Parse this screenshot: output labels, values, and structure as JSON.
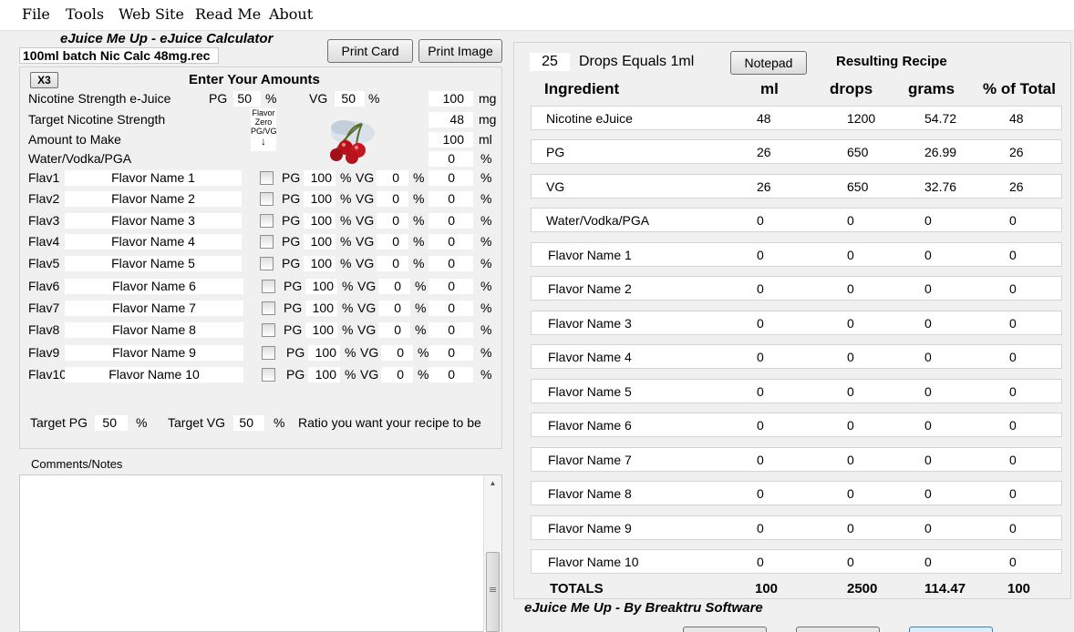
{
  "menu": [
    "File",
    "Tools",
    "Web Site",
    "Read Me",
    "About"
  ],
  "app_title": "eJuice Me Up - eJuice Calculator",
  "filename": "100ml batch Nic Calc 48mg.rec",
  "buttons": {
    "print_card": "Print Card",
    "print_image": "Print Image",
    "notepad": "Notepad",
    "x3": "X3"
  },
  "enter_amounts": "Enter Your Amounts",
  "nic": {
    "label": "Nicotine Strength e-Juice",
    "pg_label": "PG",
    "pg": "50",
    "pct": "%",
    "vg_label": "VG",
    "vg": "50",
    "strength": "100",
    "unit": "mg"
  },
  "target": {
    "label": "Target Nicotine Strength",
    "value": "48",
    "unit": "mg"
  },
  "amount": {
    "label": "Amount to Make",
    "value": "100",
    "unit": "ml"
  },
  "water": {
    "label": "Water/Vodka/PGA",
    "value": "0",
    "unit": "%"
  },
  "flavor_zero": [
    "Flavor",
    "Zero",
    "PG/VG",
    "↓"
  ],
  "flavors": [
    {
      "tag": "Flav1",
      "name": "Flavor Name 1",
      "pg": "100",
      "vg": "0",
      "pct": "0"
    },
    {
      "tag": "Flav2",
      "name": "Flavor Name 2",
      "pg": "100",
      "vg": "0",
      "pct": "0"
    },
    {
      "tag": "Flav3",
      "name": "Flavor Name 3",
      "pg": "100",
      "vg": "0",
      "pct": "0"
    },
    {
      "tag": "Flav4",
      "name": "Flavor Name 4",
      "pg": "100",
      "vg": "0",
      "pct": "0"
    },
    {
      "tag": "Flav5",
      "name": "Flavor Name 5",
      "pg": "100",
      "vg": "0",
      "pct": "0"
    },
    {
      "tag": "Flav6",
      "name": "Flavor Name 6",
      "pg": "100",
      "vg": "0",
      "pct": "0"
    },
    {
      "tag": "Flav7",
      "name": "Flavor Name 7",
      "pg": "100",
      "vg": "0",
      "pct": "0"
    },
    {
      "tag": "Flav8",
      "name": "Flavor Name 8",
      "pg": "100",
      "vg": "0",
      "pct": "0"
    },
    {
      "tag": "Flav9",
      "name": "Flavor Name 9",
      "pg": "100",
      "vg": "0",
      "pct": "0"
    },
    {
      "tag": "Flav10",
      "name": "Flavor Name 10",
      "pg": "100",
      "vg": "0",
      "pct": "0"
    }
  ],
  "flavor_labels": {
    "pg": "PG",
    "vg": "VG",
    "pct": "%"
  },
  "target_pg": {
    "label": "Target PG",
    "value": "50",
    "pct": "%"
  },
  "target_vg": {
    "label": "Target VG",
    "value": "50",
    "pct": "%"
  },
  "ratio_text": "Ratio you want your recipe to be",
  "comments_label": "Comments/Notes",
  "drops": {
    "value": "25",
    "label": "Drops Equals 1ml"
  },
  "resulting_recipe": "Resulting Recipe",
  "columns": [
    "Ingredient",
    "ml",
    "drops",
    "grams",
    "% of Total"
  ],
  "recipe": [
    {
      "name": "Nicotine eJuice",
      "ml": "48",
      "drops": "1200",
      "grams": "54.72",
      "pct": "48"
    },
    {
      "name": "PG",
      "ml": "26",
      "drops": "650",
      "grams": "26.99",
      "pct": "26"
    },
    {
      "name": "VG",
      "ml": "26",
      "drops": "650",
      "grams": "32.76",
      "pct": "26"
    },
    {
      "name": "Water/Vodka/PGA",
      "ml": "0",
      "drops": "0",
      "grams": "0",
      "pct": "0"
    },
    {
      "name": "Flavor Name 1",
      "ml": "0",
      "drops": "0",
      "grams": "0",
      "pct": "0"
    },
    {
      "name": "Flavor Name 2",
      "ml": "0",
      "drops": "0",
      "grams": "0",
      "pct": "0"
    },
    {
      "name": "Flavor Name 3",
      "ml": "0",
      "drops": "0",
      "grams": "0",
      "pct": "0"
    },
    {
      "name": "Flavor Name 4",
      "ml": "0",
      "drops": "0",
      "grams": "0",
      "pct": "0"
    },
    {
      "name": "Flavor Name 5",
      "ml": "0",
      "drops": "0",
      "grams": "0",
      "pct": "0"
    },
    {
      "name": "Flavor Name 6",
      "ml": "0",
      "drops": "0",
      "grams": "0",
      "pct": "0"
    },
    {
      "name": "Flavor Name 7",
      "ml": "0",
      "drops": "0",
      "grams": "0",
      "pct": "0"
    },
    {
      "name": "Flavor Name 8",
      "ml": "0",
      "drops": "0",
      "grams": "0",
      "pct": "0"
    },
    {
      "name": "Flavor Name 9",
      "ml": "0",
      "drops": "0",
      "grams": "0",
      "pct": "0"
    },
    {
      "name": "Flavor Name 10",
      "ml": "0",
      "drops": "0",
      "grams": "0",
      "pct": "0"
    }
  ],
  "totals": {
    "label": "TOTALS",
    "ml": "100",
    "drops": "2500",
    "grams": "114.47",
    "pct": "100"
  },
  "footer": "eJuice Me Up -  By Breaktru Software"
}
